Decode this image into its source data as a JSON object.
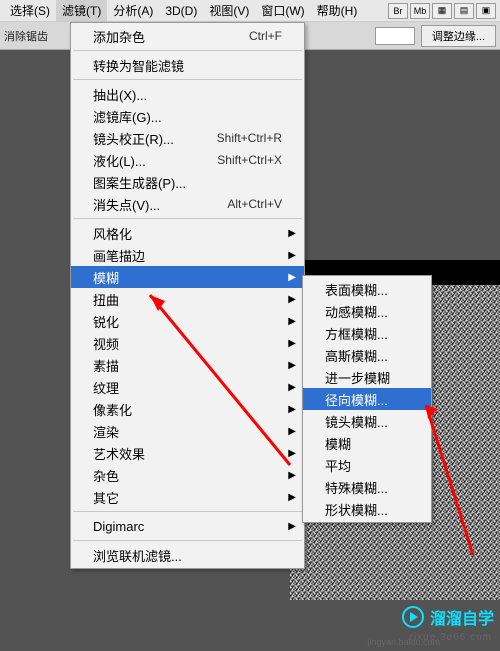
{
  "menubar": {
    "items": [
      "选择(S)",
      "滤镜(T)",
      "分析(A)",
      "3D(D)",
      "视图(V)",
      "窗口(W)",
      "帮助(H)"
    ],
    "icons": [
      "Br",
      "Mb",
      "▦",
      "▤",
      "▣"
    ]
  },
  "toolbar": {
    "antialias": "消除锯齿",
    "refine_edge": "调整边缘..."
  },
  "main_menu": {
    "s1": [
      {
        "label": "添加杂色",
        "shortcut": "Ctrl+F"
      }
    ],
    "s2": [
      {
        "label": "转换为智能滤镜"
      }
    ],
    "s3": [
      {
        "label": "抽出(X)..."
      },
      {
        "label": "滤镜库(G)..."
      },
      {
        "label": "镜头校正(R)...",
        "shortcut": "Shift+Ctrl+R"
      },
      {
        "label": "液化(L)...",
        "shortcut": "Shift+Ctrl+X"
      },
      {
        "label": "图案生成器(P)..."
      },
      {
        "label": "消失点(V)...",
        "shortcut": "Alt+Ctrl+V"
      }
    ],
    "s4": [
      {
        "label": "风格化",
        "sub": true
      },
      {
        "label": "画笔描边",
        "sub": true
      },
      {
        "label": "模糊",
        "sub": true,
        "highlight": true
      },
      {
        "label": "扭曲",
        "sub": true
      },
      {
        "label": "锐化",
        "sub": true
      },
      {
        "label": "视频",
        "sub": true
      },
      {
        "label": "素描",
        "sub": true
      },
      {
        "label": "纹理",
        "sub": true
      },
      {
        "label": "像素化",
        "sub": true
      },
      {
        "label": "渲染",
        "sub": true
      },
      {
        "label": "艺术效果",
        "sub": true
      },
      {
        "label": "杂色",
        "sub": true
      },
      {
        "label": "其它",
        "sub": true
      }
    ],
    "s5": [
      {
        "label": "Digimarc",
        "sub": true
      }
    ],
    "s6": [
      {
        "label": "浏览联机滤镜..."
      }
    ]
  },
  "sub_menu": [
    {
      "label": "表面模糊..."
    },
    {
      "label": "动感模糊..."
    },
    {
      "label": "方框模糊..."
    },
    {
      "label": "高斯模糊..."
    },
    {
      "label": "进一步模糊"
    },
    {
      "label": "径向模糊...",
      "highlight": true
    },
    {
      "label": "镜头模糊..."
    },
    {
      "label": "模糊"
    },
    {
      "label": "平均"
    },
    {
      "label": "特殊模糊..."
    },
    {
      "label": "形状模糊..."
    }
  ],
  "watermark": {
    "text": "溜溜自学",
    "sub": "zixue.3d66.com",
    "small": "jingyan.baidu.com"
  }
}
